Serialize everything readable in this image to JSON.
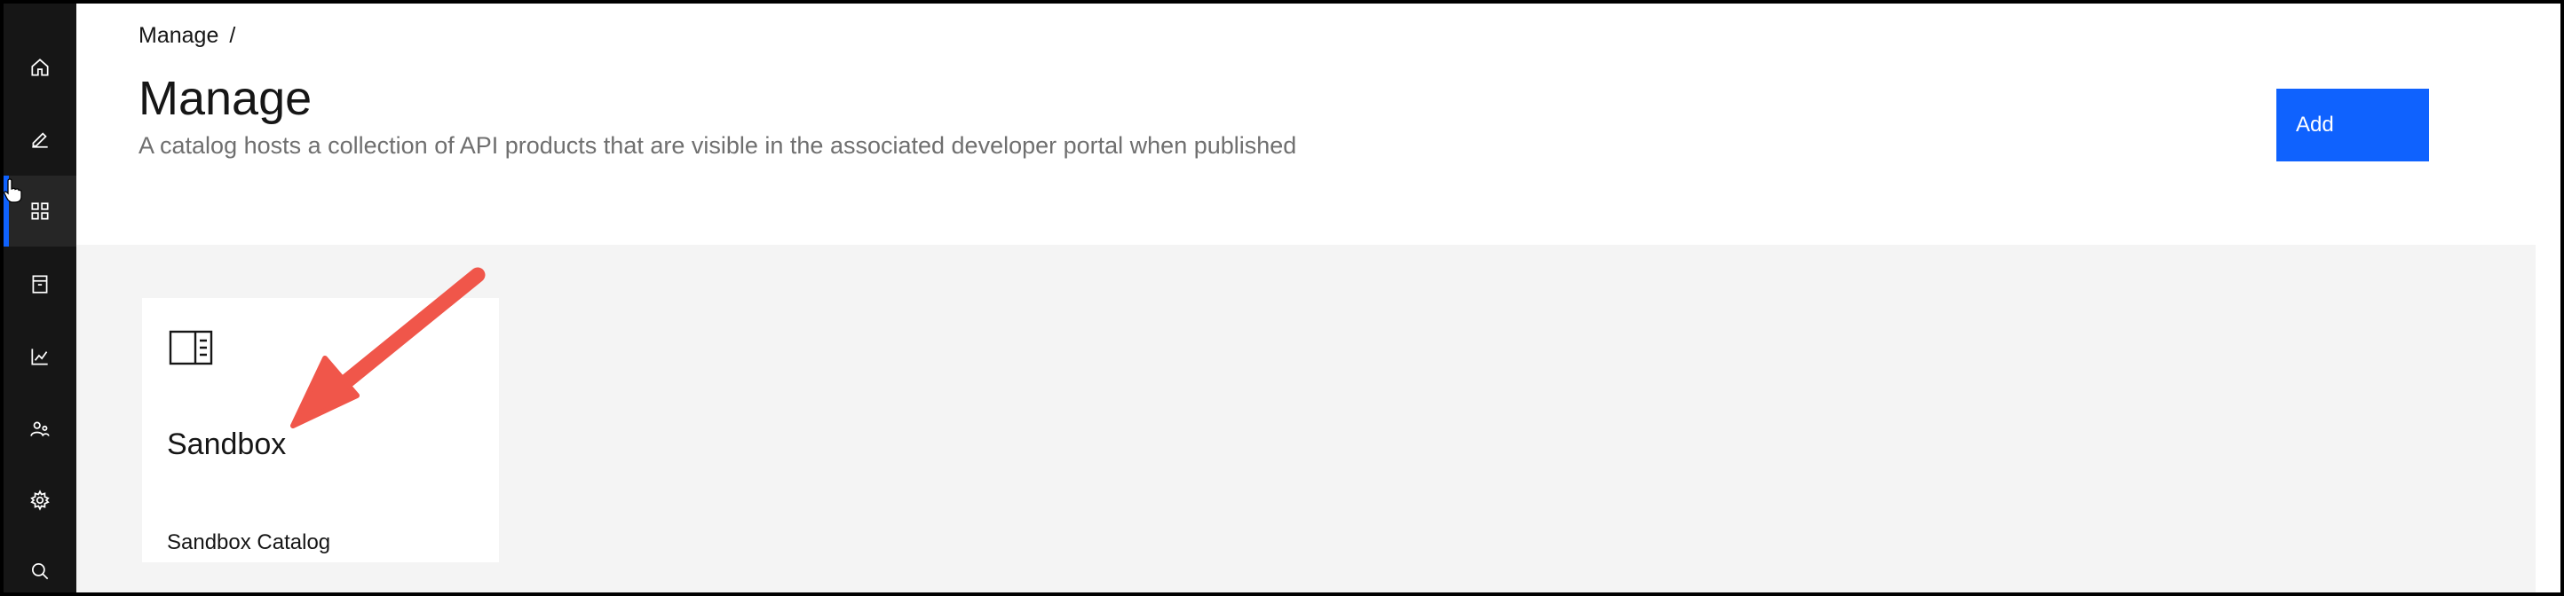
{
  "sidebar": {
    "items": [
      {
        "icon": "home-icon",
        "active": false
      },
      {
        "icon": "edit-icon",
        "active": false
      },
      {
        "icon": "grid-icon",
        "active": true
      },
      {
        "icon": "catalog-icon",
        "active": false
      },
      {
        "icon": "analytics-icon",
        "active": false
      },
      {
        "icon": "members-icon",
        "active": false
      },
      {
        "icon": "settings-icon",
        "active": false
      },
      {
        "icon": "search-icon",
        "active": false
      }
    ]
  },
  "header": {
    "breadcrumb": {
      "item": "Manage",
      "separator": "/"
    },
    "title": "Manage",
    "description": "A catalog hosts a collection of API products that are visible in the associated developer portal when published",
    "add_label": "Add"
  },
  "tiles": [
    {
      "icon": "catalog-panel-icon",
      "title": "Sandbox",
      "subtitle": "Sandbox Catalog"
    }
  ],
  "colors": {
    "sidebar_bg": "#161616",
    "accent": "#0f62fe",
    "content_bg": "#f4f4f4",
    "annotation_arrow": "#f0564a"
  }
}
